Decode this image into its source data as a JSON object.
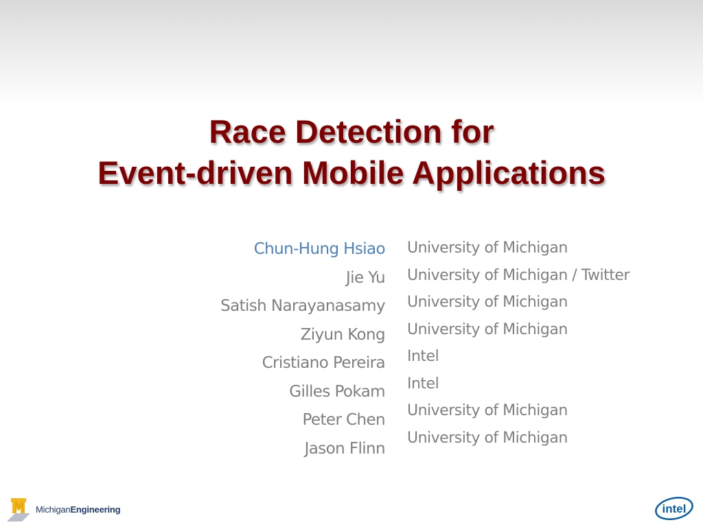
{
  "slide": {
    "title_line1": "Race Detection for",
    "title_line2": "Event-driven Mobile Applications",
    "colors": {
      "title": "#7f0000",
      "presenter": "#4f81bd",
      "text": "#7f7f7f"
    },
    "authors": [
      {
        "name": "Chun-Hung Hsiao",
        "affiliation": "University of Michigan",
        "presenter": true
      },
      {
        "name": "Jie Yu",
        "affiliation": "University of Michigan / Twitter"
      },
      {
        "name": "Satish Narayanasamy",
        "affiliation": "University of Michigan"
      },
      {
        "name": "Ziyun Kong",
        "affiliation": "University of Michigan"
      },
      {
        "name": "Cristiano Pereira",
        "affiliation": "Intel"
      },
      {
        "name": "Gilles Pokam",
        "affiliation": "Intel"
      },
      {
        "name": "Peter Chen",
        "affiliation": "University of Michigan"
      },
      {
        "name": "Jason Flinn",
        "affiliation": "University of Michigan"
      }
    ],
    "logos": {
      "michigan_part1": "Michigan",
      "michigan_part2": "Engineering",
      "intel": "intel"
    }
  }
}
